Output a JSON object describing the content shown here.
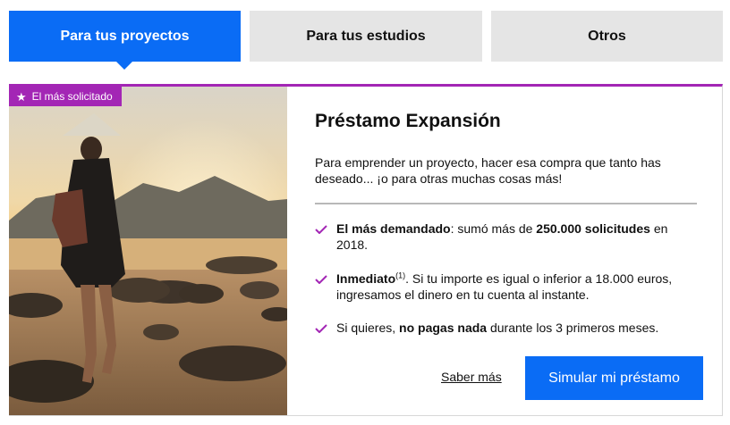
{
  "tabs": [
    {
      "label": "Para tus proyectos",
      "active": true
    },
    {
      "label": "Para tus estudios",
      "active": false
    },
    {
      "label": "Otros",
      "active": false
    }
  ],
  "colors": {
    "accent_blue": "#0a6cf5",
    "accent_purple": "#a326b5",
    "tab_inactive": "#e5e5e5"
  },
  "card": {
    "badge": {
      "icon": "star-icon",
      "label": "El más solicitado"
    },
    "title": "Préstamo Expansión",
    "description": "Para emprender un proyecto, hacer esa compra que tanto has deseado... ¡o para otras muchas cosas más!",
    "features": [
      {
        "parts": [
          {
            "b": "El más demandado"
          },
          {
            "t": ": sumó más de "
          },
          {
            "b": "250.000 solicitudes"
          },
          {
            "t": " en 2018."
          }
        ]
      },
      {
        "parts": [
          {
            "b": "Inmediato"
          },
          {
            "sup": "(1)"
          },
          {
            "t": ". Si tu importe es igual o inferior a 18.000 euros, ingresamos el dinero en tu cuenta al instante."
          }
        ]
      },
      {
        "parts": [
          {
            "t": "Si quieres, "
          },
          {
            "b": "no pagas nada"
          },
          {
            "t": " durante los 3 primeros meses."
          }
        ]
      }
    ],
    "feature_icon": "check-icon",
    "link_label": "Saber más",
    "cta_label": "Simular mi préstamo"
  }
}
